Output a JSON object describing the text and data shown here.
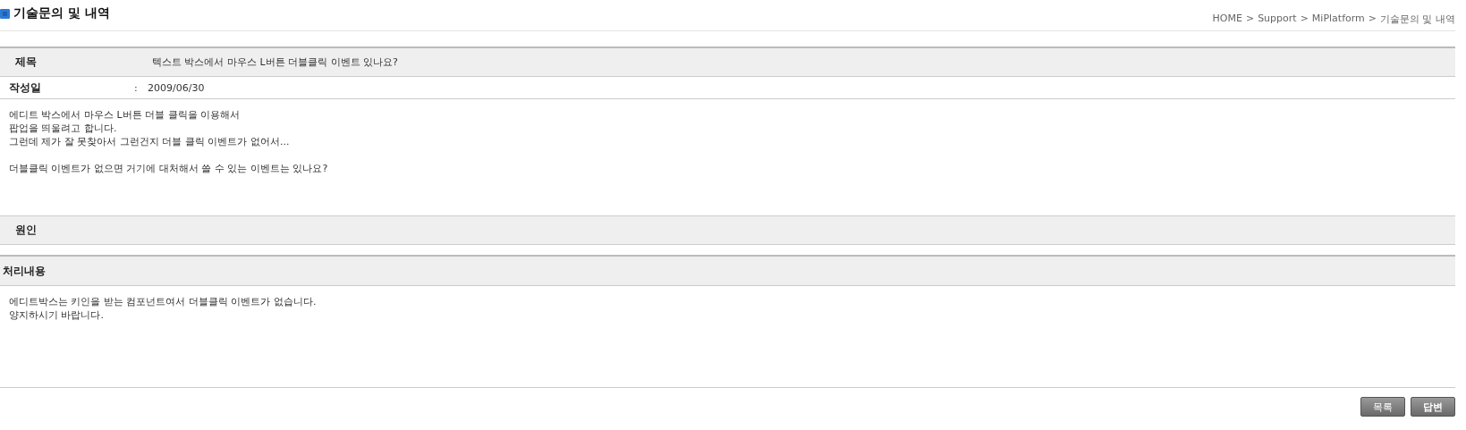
{
  "page_title": "기술문의 및 내역",
  "breadcrumb": [
    "HOME",
    "Support",
    "MiPlatform",
    "기술문의 및 내역"
  ],
  "breadcrumb_separator": ">",
  "subject": {
    "label": "제목",
    "value": "텍스트 박스에서 마우스 L버튼 더블클릭 이벤트 있나요?"
  },
  "date": {
    "label": "작성일",
    "separator": ":",
    "value": "2009/06/30"
  },
  "question_paragraphs": [
    [
      "에디트 박스에서 마우스 L버튼 더블 클릭을 이용해서",
      "팝업을 띄울려고 합니다.",
      "그런데 제가 잘 못찾아서 그런건지 더블 클릭 이벤트가 없어서..."
    ],
    [
      "더블클릭 이벤트가 없으면 거기에 대처해서 쓸 수 있는 이벤트는 있나요?"
    ]
  ],
  "cause": {
    "label": "원인"
  },
  "resolution": {
    "label": "처리내용",
    "lines": [
      "에디트박스는 키인을 받는 컴포넌트여서 더블클릭 이벤트가 없습니다.",
      "양지하시기 바랍니다."
    ]
  },
  "buttons": [
    "목록",
    "답변"
  ]
}
